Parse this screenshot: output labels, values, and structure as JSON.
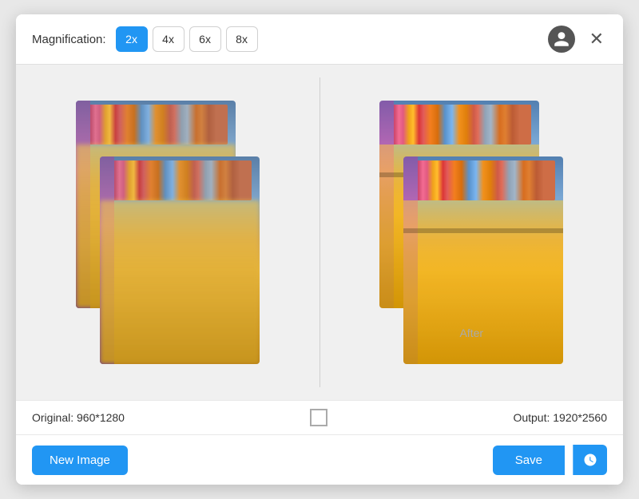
{
  "toolbar": {
    "magnification_label": "Magnification:",
    "mag_buttons": [
      {
        "label": "2x",
        "active": true
      },
      {
        "label": "4x",
        "active": false
      },
      {
        "label": "6x",
        "active": false
      },
      {
        "label": "8x",
        "active": false
      }
    ]
  },
  "image_panels": {
    "after_label": "After",
    "original_info": "Original: 960*1280",
    "output_info": "Output: 1920*2560"
  },
  "footer": {
    "new_image_label": "New Image",
    "save_label": "Save"
  }
}
